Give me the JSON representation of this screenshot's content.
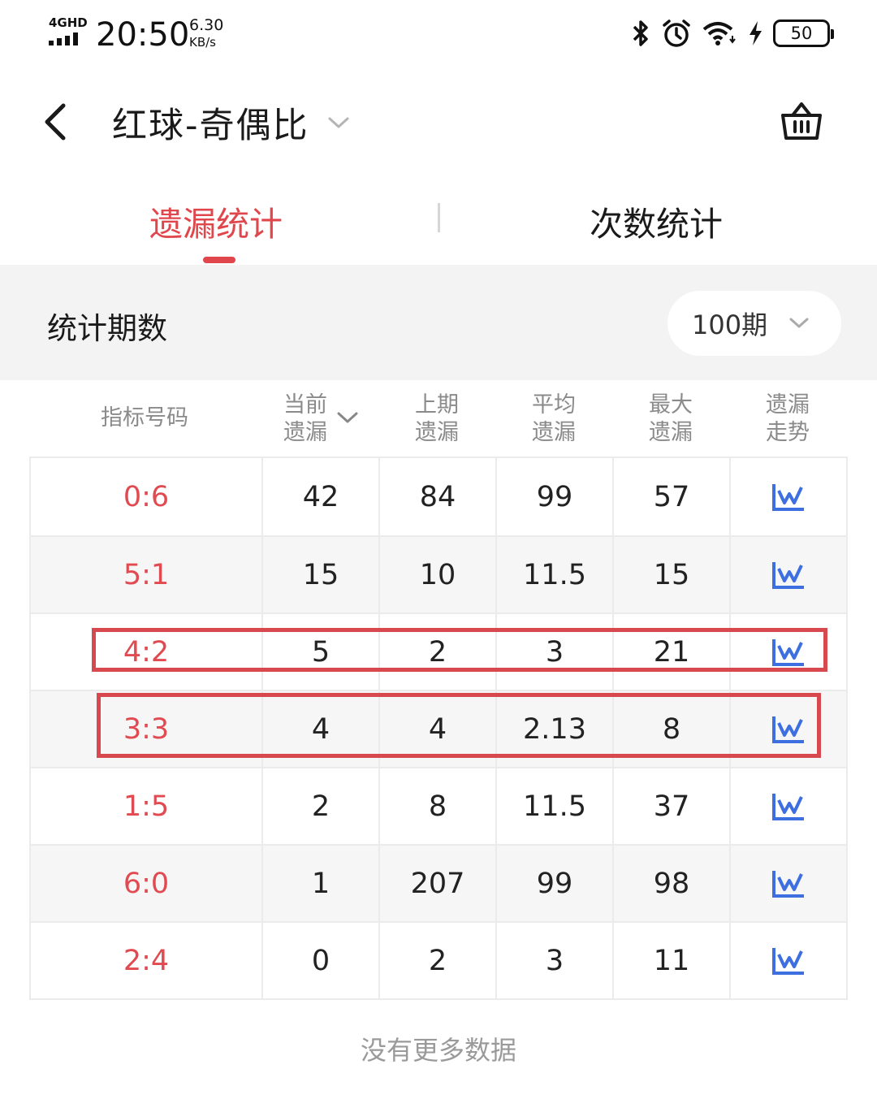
{
  "status_bar": {
    "network": "4GHD",
    "time": "20:50",
    "speed_value": "6.30",
    "speed_unit": "KB/s",
    "battery": "50"
  },
  "header": {
    "title": "红球-奇偶比",
    "title_icon": "chevron-down-icon",
    "back_icon": "back-arrow-icon",
    "right_icon": "basket-icon"
  },
  "tabs": [
    {
      "label": "遗漏统计",
      "active": true
    },
    {
      "label": "次数统计",
      "active": false
    }
  ],
  "period": {
    "label": "统计期数",
    "selected": "100期"
  },
  "table": {
    "columns": [
      {
        "line1": "指标号码",
        "line2": ""
      },
      {
        "line1": "当前",
        "line2": "遗漏"
      },
      {
        "line1": "上期",
        "line2": "遗漏"
      },
      {
        "line1": "平均",
        "line2": "遗漏"
      },
      {
        "line1": "最大",
        "line2": "遗漏"
      },
      {
        "line1": "遗漏",
        "line2": "走势"
      }
    ],
    "rows": [
      {
        "label": "0:6",
        "current": "42",
        "previous": "84",
        "average": "99",
        "max": "57"
      },
      {
        "label": "5:1",
        "current": "15",
        "previous": "10",
        "average": "11.5",
        "max": "15"
      },
      {
        "label": "4:2",
        "current": "5",
        "previous": "2",
        "average": "3",
        "max": "21"
      },
      {
        "label": "3:3",
        "current": "4",
        "previous": "4",
        "average": "2.13",
        "max": "8"
      },
      {
        "label": "1:5",
        "current": "2",
        "previous": "8",
        "average": "11.5",
        "max": "37"
      },
      {
        "label": "6:0",
        "current": "1",
        "previous": "207",
        "average": "99",
        "max": "98"
      },
      {
        "label": "2:4",
        "current": "0",
        "previous": "2",
        "average": "3",
        "max": "11"
      }
    ],
    "trend_icon": "trend-chart-icon"
  },
  "footer": "没有更多数据",
  "colors": {
    "accent": "#e0474c",
    "highlight_border": "#d8484f",
    "trend_blue": "#3d6fe0",
    "band_bg": "#f3f3f3"
  }
}
